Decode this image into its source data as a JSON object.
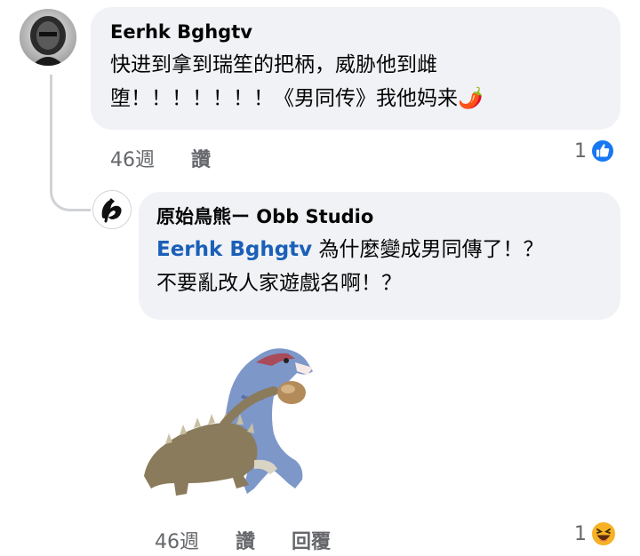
{
  "comment": {
    "author": "Eerhk Bghgtv",
    "lines": [
      "快进到拿到瑞笙的把柄，威胁他到雌",
      "堕！！！！！！！《男同传》我他妈来🌶️"
    ],
    "time": "46週",
    "like_label": "讚",
    "reaction_count": "1",
    "reaction_icon": "thumbs-up-icon",
    "reaction_color": "#1877f2"
  },
  "reply": {
    "author": "原始鳥熊ー Obb Studio",
    "mention": "Eerhk Bghgtv",
    "line1_rest": " 為什麼變成男同傳了！？",
    "line2": "不要亂改人家遊戲名啊！？",
    "sticker_icon": "dinosaur-sticker",
    "time": "46週",
    "like_label": "讚",
    "reply_label": "回覆",
    "reaction_count": "1",
    "reaction_icon": "laughing-emoji-icon",
    "reaction_color": "#f7b125"
  }
}
